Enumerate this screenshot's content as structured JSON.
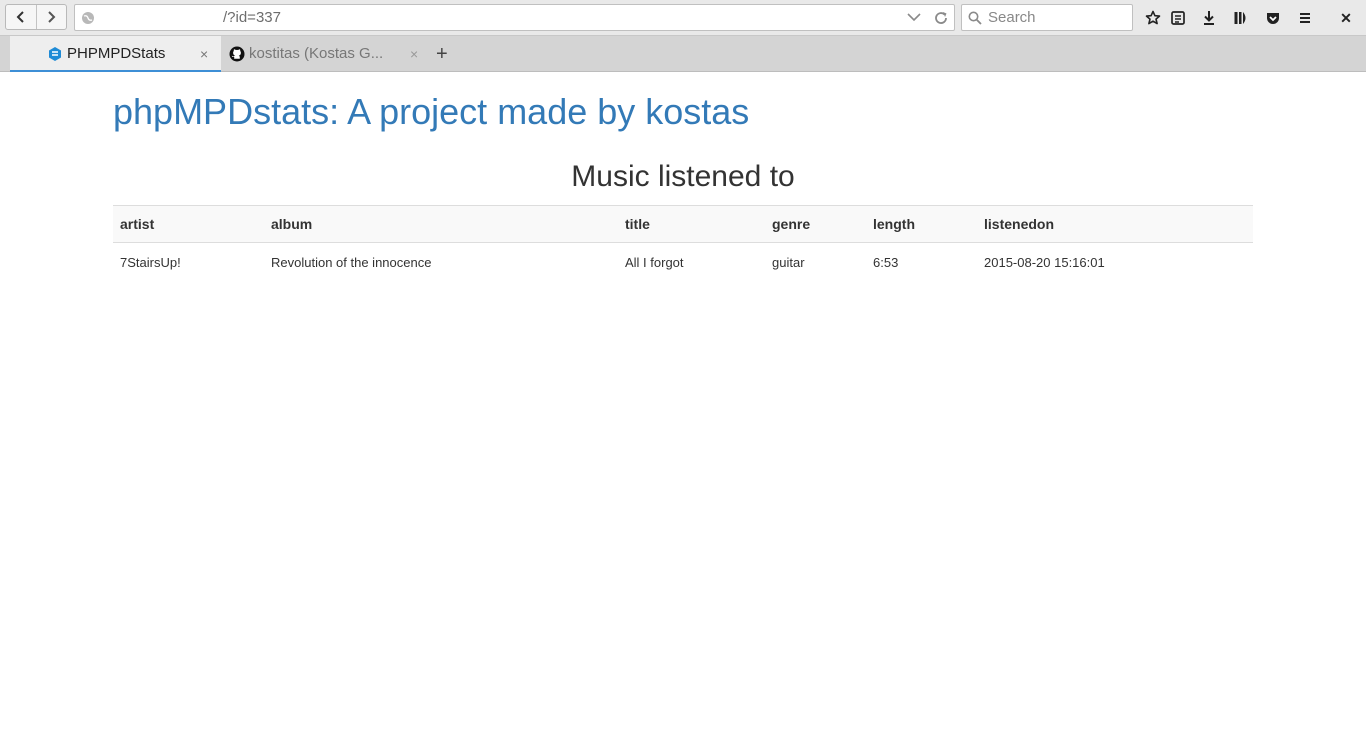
{
  "browser": {
    "url": "/?id=337",
    "search_placeholder": "Search",
    "tabs": [
      {
        "title": "PHPMPDStats",
        "active": true
      },
      {
        "title": "kostitas (Kostas G...",
        "active": false
      }
    ],
    "new_tab_symbol": "+",
    "close_symbol": "×",
    "window_close_symbol": "✕",
    "accent_color": "#3d8fd6",
    "toolbar_icons": [
      "bookmark-star-icon",
      "reading-list-icon",
      "downloads-icon",
      "library-icon",
      "pocket-icon",
      "menu-icon"
    ]
  },
  "page": {
    "title": "phpMPDstats: A project made by kostas",
    "title_color": "#337ab7",
    "section_title": "Music listened to",
    "table": {
      "columns": [
        "artist",
        "album",
        "title",
        "genre",
        "length",
        "listenedon"
      ],
      "rows": [
        [
          "7StairsUp!",
          "Revolution of the innocence",
          "All I forgot",
          "guitar",
          "6:53",
          "2015-08-20 15:16:01"
        ]
      ]
    }
  }
}
